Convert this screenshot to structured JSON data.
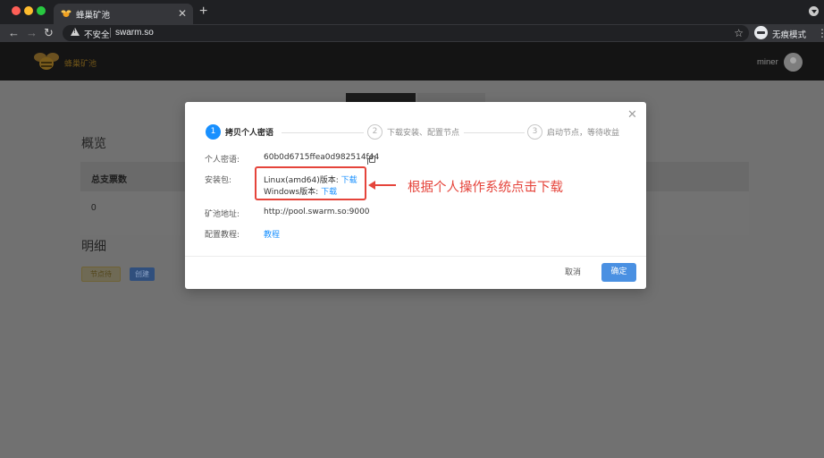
{
  "browser": {
    "tab_title": "蜂巢矿池",
    "tab_close": "✕",
    "new_tab": "+",
    "security_label": "不安全",
    "url": "swarm.so",
    "incognito_label": "无痕模式",
    "icons": [
      "back-icon",
      "forward-icon",
      "reload-icon",
      "warning-icon",
      "star-icon",
      "incognito-icon",
      "menu-icon"
    ]
  },
  "site": {
    "name": "蜂巢矿池",
    "user": "miner"
  },
  "background": {
    "overview_title": "概览",
    "overview_column": "总支票数",
    "overview_value": "0",
    "detail_title": "明细",
    "pending_button": "节点待",
    "create_button": "创建"
  },
  "modal": {
    "close": "✕",
    "steps": [
      {
        "number": "1",
        "label": "拷贝个人密语",
        "active": true
      },
      {
        "number": "2",
        "label": "下载安装、配置节点",
        "active": false
      },
      {
        "number": "3",
        "label": "启动节点，等待收益",
        "active": false
      }
    ],
    "fields": {
      "secret_label": "个人密语:",
      "secret_value": "60b0d6715ffea0d982514f44",
      "package_label": "安装包:",
      "linux_text": "Linux(amd64)版本:",
      "linux_link": "下载",
      "windows_text": "Windows版本:",
      "windows_link": "下载",
      "pool_label": "矿池地址:",
      "pool_value": "http://pool.swarm.so:9000",
      "tutorial_label": "配置教程:",
      "tutorial_link": "教程"
    },
    "cancel": "取消",
    "ok": "确定"
  },
  "annotation": {
    "text": "根据个人操作系统点击下载",
    "color": "#e5443b"
  },
  "colors": {
    "accent": "#1890ff",
    "primary_button": "#4a90e2",
    "annotation": "#e5443b"
  }
}
